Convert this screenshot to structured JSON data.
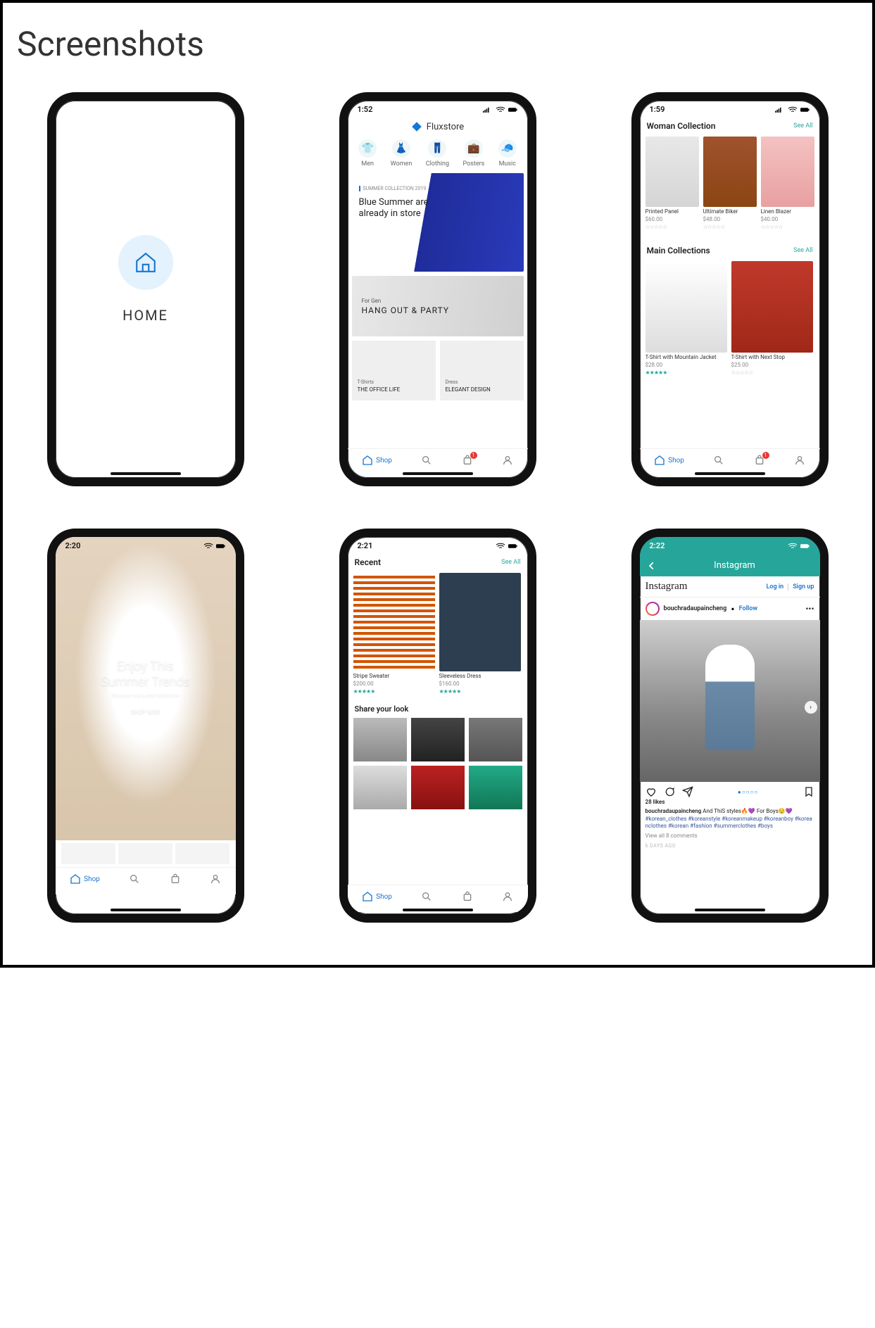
{
  "page": {
    "title": "Screenshots"
  },
  "phone1": {
    "home_label": "HOME"
  },
  "phone2": {
    "time": "1:52",
    "brand": "Fluxstore",
    "categories": [
      {
        "label": "Men",
        "glyph": "👕"
      },
      {
        "label": "Women",
        "glyph": "👗"
      },
      {
        "label": "Clothing",
        "glyph": "👖"
      },
      {
        "label": "Posters",
        "glyph": "💼"
      },
      {
        "label": "Music",
        "glyph": "🧢"
      }
    ],
    "banner_tag": "SUMMER COLLECTION 2019",
    "banner_title": "Blue Summer are already in store",
    "banner2_tag": "For Gen",
    "banner2_title": "HANG OUT & PARTY",
    "mini": [
      {
        "tag": "T-Shirts",
        "title": "THE OFFICE LIFE"
      },
      {
        "tag": "Dress",
        "title": "ELEGANT DESIGN"
      }
    ],
    "tab_shop": "Shop",
    "cart_badge": "1"
  },
  "phone3": {
    "time": "1:59",
    "sec1_title": "Woman Collection",
    "see_all": "See All",
    "sec1_items": [
      {
        "name": "Printed Panel",
        "price": "$60.00",
        "rated": false
      },
      {
        "name": "Ultimate Biker",
        "price": "$48.00",
        "rated": false
      },
      {
        "name": "Linen Blazer",
        "price": "$40.00",
        "rated": false
      }
    ],
    "sec2_title": "Main Collections",
    "sec2_items": [
      {
        "name": "T-Shirt with Mountain Jacket",
        "price": "$28.00",
        "rated": true
      },
      {
        "name": "T-Shirt with Next Stop",
        "price": "$25.00",
        "rated": false
      }
    ],
    "tab_shop": "Shop",
    "cart_badge": "1"
  },
  "phone4": {
    "time": "2:20",
    "hero_title_l1": "Enjoy This",
    "hero_title_l2": "Summer Trends",
    "hero_sub": "Discover now Latest Collection",
    "hero_btn": "SHOP NOW",
    "tab_shop": "Shop"
  },
  "phone5": {
    "time": "2:21",
    "recent_title": "Recent",
    "see_all": "See All",
    "recent_items": [
      {
        "name": "Stripe Sweater",
        "price": "$200.00",
        "rated": true
      },
      {
        "name": "Sleeveless Dress",
        "price": "$160.00",
        "rated": true
      }
    ],
    "share_title": "Share your look",
    "tab_shop": "Shop"
  },
  "phone6": {
    "time": "2:22",
    "topbar_title": "Instagram",
    "logo": "Instagram",
    "login": "Log in",
    "signup": "Sign up",
    "username": "bouchradaupaincheng",
    "follow": "Follow",
    "sep": " • ",
    "more": "•••",
    "likes": "28 likes",
    "cap_user": "bouchradaupaincheng",
    "cap_text": " And ThiS styles🔥💜 For Boys😒💜",
    "hashtags": "#korean_clothes #koreanstyle #koreanmakeup #koreanboy #koreanclothes #korean #fashion #summerclothes #boys",
    "view_comments": "View all 8 comments",
    "time_ago": "6 DAYS AGO"
  }
}
